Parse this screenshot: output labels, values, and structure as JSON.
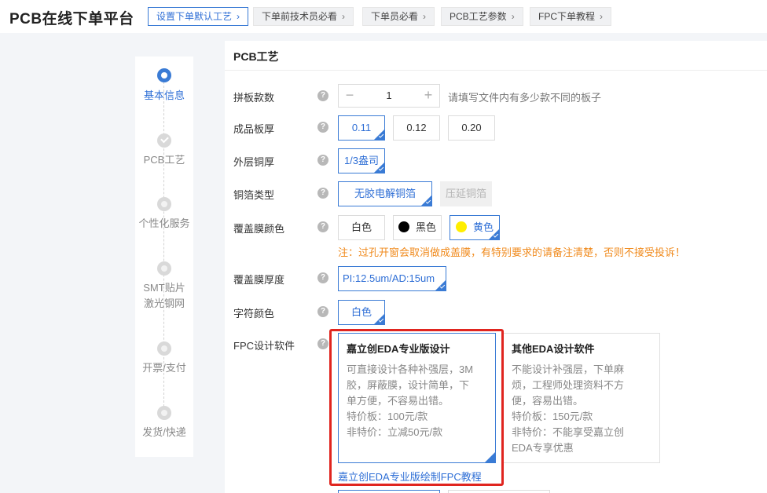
{
  "header": {
    "brand": "PCB在线下单平台",
    "nav": [
      {
        "label": "设置下单默认工艺"
      },
      {
        "label": "下单前技术员必看"
      },
      {
        "label": "下单员必看"
      },
      {
        "label": "PCB工艺参数"
      },
      {
        "label": "FPC下单教程"
      }
    ],
    "chevron": "›"
  },
  "steps": [
    {
      "label": "基本信息",
      "state": "active"
    },
    {
      "label": "PCB工艺",
      "state": "done"
    },
    {
      "label": "个性化服务",
      "state": "todo"
    },
    {
      "label": "SMT贴片",
      "label2": "激光钢网",
      "state": "todo"
    },
    {
      "label": "开票/支付",
      "state": "todo"
    },
    {
      "label": "发货/快递",
      "state": "todo"
    }
  ],
  "section": {
    "title": "PCB工艺"
  },
  "help_glyph": "?",
  "form": {
    "panel_count": {
      "label": "拼板款数",
      "value": "1",
      "minus": "−",
      "plus": "+",
      "hint": "请填写文件内有多少款不同的板子"
    },
    "thickness": {
      "label": "成品板厚",
      "options": [
        "0.11",
        "0.12",
        "0.20"
      ],
      "selected": "0.11"
    },
    "outer_copper": {
      "label": "外层铜厚",
      "options": [
        "1/3盎司"
      ],
      "selected": "1/3盎司"
    },
    "foil_type": {
      "label": "铜箔类型",
      "options": [
        "无胶电解铜箔",
        "压延铜箔"
      ],
      "selected": "无胶电解铜箔",
      "disabled": [
        "压延铜箔"
      ]
    },
    "coverlay_color": {
      "label": "覆盖膜颜色",
      "options": [
        {
          "label": "白色",
          "color": ""
        },
        {
          "label": "黑色",
          "color": "#000000"
        },
        {
          "label": "黄色",
          "color": "#ffee00"
        }
      ],
      "selected": "黄色",
      "note": "注：过孔开窗会取消做成盖膜，有特别要求的请备注清楚，否则不接受投诉！"
    },
    "coverlay_thickness": {
      "label": "覆盖膜厚度",
      "options": [
        "PI:12.5um/AD:15um"
      ],
      "selected": "PI:12.5um/AD:15um"
    },
    "silkscreen": {
      "label": "字符颜色",
      "options": [
        "白色"
      ],
      "selected": "白色"
    },
    "fpc_software": {
      "label": "FPC设计软件",
      "cards": [
        {
          "title": "嘉立创EDA专业版设计",
          "lines": [
            "可直接设计各种补强层，3M",
            "胶，屏蔽膜，设计简单，下",
            "单方便，不容易出错。",
            "特价板：100元/款",
            "非特价：立减50元/款"
          ],
          "selected": true
        },
        {
          "title": "其他EDA设计软件",
          "lines": [
            "不能设计补强层，下单麻",
            "烦，工程师处理资料不方",
            "便，容易出错。",
            "特价板：150元/款",
            "非特价：不能享受嘉立创",
            "EDA专享优惠"
          ],
          "selected": false
        }
      ],
      "tutorial_link": "嘉立创EDA专业版绘制FPC教程"
    }
  },
  "colors": {
    "accent": "#3a7bd5",
    "warning": "#f08a1c",
    "highlight_frame": "#e0251f"
  }
}
